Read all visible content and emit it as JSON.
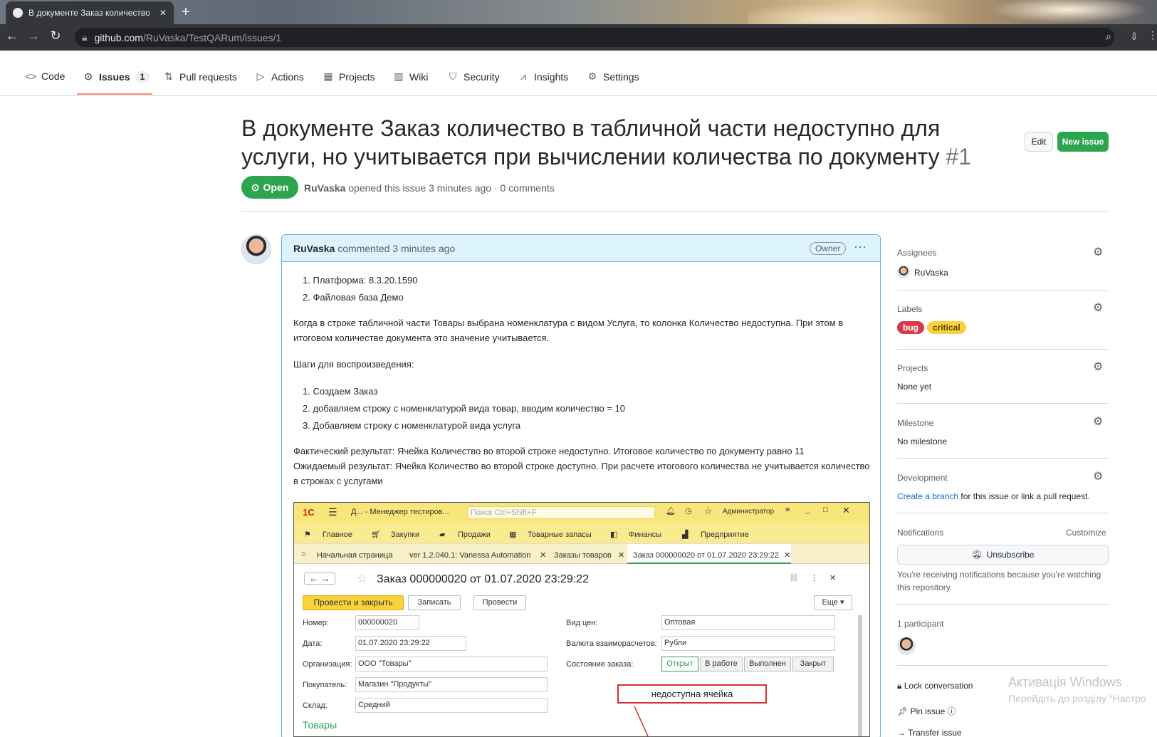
{
  "browser": {
    "tab_title": "В документе Заказ количество",
    "url_host": "github.com",
    "url_path": "/RuVaska/TestQARum/issues/1",
    "new_tab": "+"
  },
  "repo_nav": {
    "items": [
      {
        "icon": "code-icon",
        "label": "Code"
      },
      {
        "icon": "issue-icon",
        "label": "Issues",
        "count": "1"
      },
      {
        "icon": "pull-request-icon",
        "label": "Pull requests"
      },
      {
        "icon": "play-icon",
        "label": "Actions"
      },
      {
        "icon": "table-icon",
        "label": "Projects"
      },
      {
        "icon": "book-icon",
        "label": "Wiki"
      },
      {
        "icon": "shield-icon",
        "label": "Security"
      },
      {
        "icon": "graph-icon",
        "label": "Insights"
      },
      {
        "icon": "gear-icon",
        "label": "Settings"
      }
    ]
  },
  "issue": {
    "title": "В документе Заказ количество в табличной части недоступно для услуги, но учитывается при вычислении количества по документу",
    "number": "#1",
    "edit_label": "Edit",
    "new_issue_label": "New issue",
    "status": "Open",
    "author": "RuVaska",
    "meta": "opened this issue 3 minutes ago · 0 comments"
  },
  "comment": {
    "author": "RuVaska",
    "time": "commented 3 minutes ago",
    "owner_badge": "Owner",
    "list1": [
      "Платформа: 8.3.20.1590",
      "Файловая база Демо"
    ],
    "para1": "Когда в строке табличной части Товары выбрана номенклатура с видом Услуга, то колонка Количество недоступна. При этом в итоговом количестве документа это значение учитывается.",
    "steps_title": "Шаги для воспроизведения:",
    "list2": [
      "Создаем Заказ",
      "добавляем строку с номенклатурой вида товар, вводим количество = 10",
      "Добавляем строку с номенклатурой вида услуга"
    ],
    "actual": "Фактический результат: Ячейка Количество во второй строке недоступно. Итоговое количество по документу равно 11",
    "expected": "Ожидаемый результат: Ячейка Количество во второй строке доступно. При расчете итогового количества не учитывается количество в строках с услугами"
  },
  "screenshot": {
    "app_title": "Д... - Менеджер тестиров...",
    "search_placeholder": "Поиск Ctrl+Shift+F",
    "user": "Администратор",
    "menu": [
      "Главное",
      "Закупки",
      "Продажи",
      "Товарные запасы",
      "Финансы",
      "Предприятие"
    ],
    "tabs": [
      "Начальная страница",
      "ver 1.2.040.1: Vanessa Automation",
      "Заказы товаров",
      "Заказ 000000020 от 01.07.2020 23:29:22"
    ],
    "doc_title": "Заказ 000000020 от 01.07.2020 23:29:22",
    "btn_post_close": "Провести и закрыть",
    "btn_save": "Записать",
    "btn_post": "Провести",
    "btn_more": "Еще",
    "fields": [
      {
        "label": "Номер:",
        "value": "000000020"
      },
      {
        "label": "Дата:",
        "value": "01.07.2020 23:29:22"
      },
      {
        "label": "Организация:",
        "value": "ООО \"Товары\""
      },
      {
        "label": "Покупатель:",
        "value": "Магазин \"Продукты\""
      },
      {
        "label": "Склад:",
        "value": "Средний"
      }
    ],
    "fields_right": [
      {
        "label": "Вид цен:",
        "value": "Оптовая"
      },
      {
        "label": "Валюта взаиморасчетов:",
        "value": "Рубли"
      },
      {
        "label": "Состояние заказа:",
        "value": ""
      }
    ],
    "states": [
      "Открыт",
      "В работе",
      "Выполнен",
      "Закрыт"
    ],
    "annotation": "недоступна ячейка",
    "section": "Товары"
  },
  "sidebar": {
    "assignees_h": "Assignees",
    "assignee": "RuVaska",
    "labels_h": "Labels",
    "labels": [
      {
        "name": "bug",
        "color": "#d73a4a"
      },
      {
        "name": "critical",
        "color": "#f9d23c"
      }
    ],
    "projects_h": "Projects",
    "projects_v": "None yet",
    "milestone_h": "Milestone",
    "milestone_v": "No milestone",
    "development_h": "Development",
    "dev_link": "Create a branch",
    "dev_rest": "for this issue or link a pull request.",
    "notifications_h": "Notifications",
    "customize": "Customize",
    "unsubscribe": "Unsubscribe",
    "notif_text": "You're receiving notifications because you're watching this repository.",
    "participants_h": "1 participant",
    "lock": "Lock conversation",
    "pin": "Pin issue",
    "transfer": "Transfer issue"
  },
  "windows": {
    "line1": "Активація Windows",
    "line2": "Перейдіть до розділу \"Настро"
  }
}
